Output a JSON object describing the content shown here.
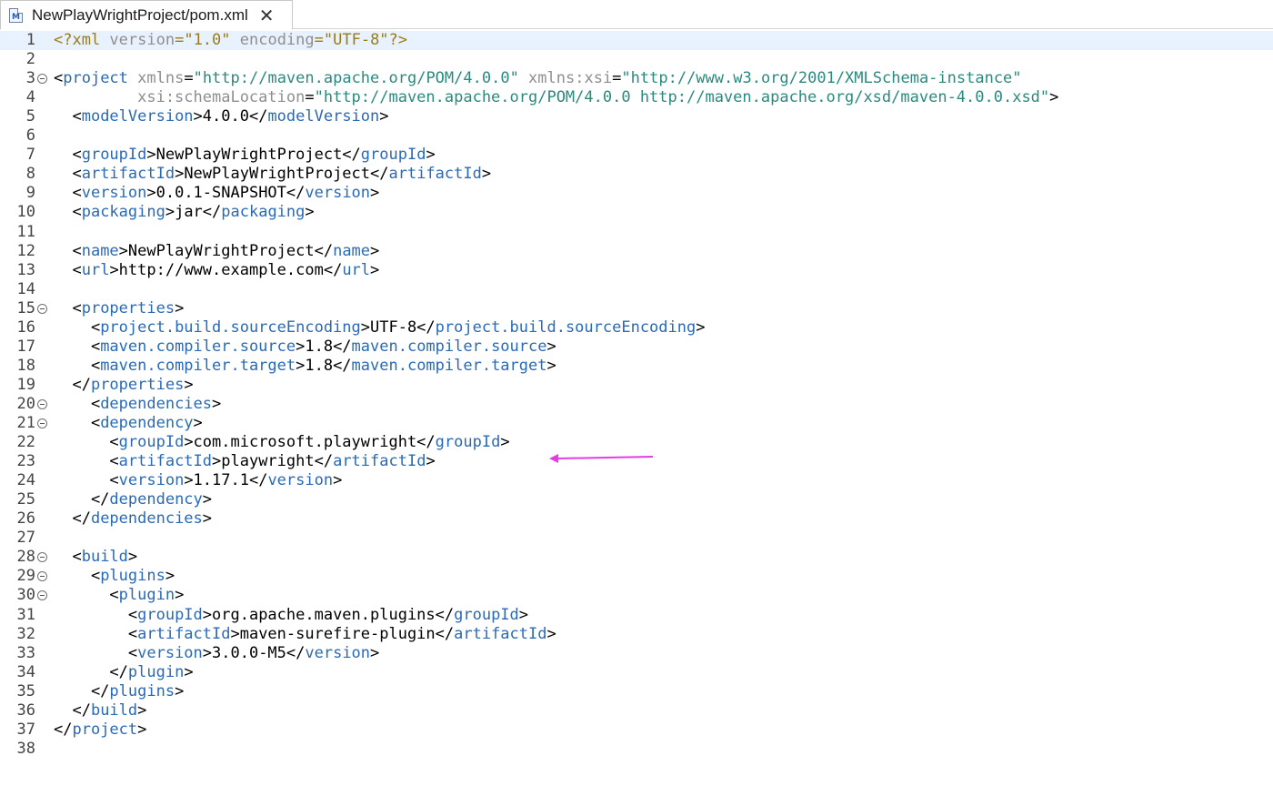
{
  "tab": {
    "title": "NewPlayWrightProject/pom.xml",
    "icon": "maven-file-icon",
    "icon_letter": "M",
    "close_glyph": "✕"
  },
  "colors": {
    "tag": "#2a6ab5",
    "attr": "#8f8f8f",
    "string": "#2a8a7e",
    "pi": "#9a7b17",
    "text": "#000000",
    "current_line": "#e8f2fe",
    "annotation_arrow": "#e43ce4"
  },
  "current_line": 1,
  "lines": [
    {
      "n": "1",
      "fold": false,
      "tokens": [
        {
          "t": "pi",
          "v": "<?xml "
        },
        {
          "t": "attr",
          "v": "version"
        },
        {
          "t": "pi",
          "v": "="
        },
        {
          "t": "pi",
          "v": "\"1.0\""
        },
        {
          "t": "attr",
          "v": " encoding"
        },
        {
          "t": "pi",
          "v": "="
        },
        {
          "t": "pi",
          "v": "\"UTF-8\""
        },
        {
          "t": "pi",
          "v": "?>"
        }
      ]
    },
    {
      "n": "2",
      "fold": false,
      "tokens": []
    },
    {
      "n": "3",
      "fold": true,
      "tokens": [
        {
          "t": "text",
          "v": "<"
        },
        {
          "t": "tag",
          "v": "project"
        },
        {
          "t": "attr",
          "v": " xmlns"
        },
        {
          "t": "text",
          "v": "="
        },
        {
          "t": "string",
          "v": "\"http://maven.apache.org/POM/4.0.0\""
        },
        {
          "t": "attr",
          "v": " xmlns:xsi"
        },
        {
          "t": "text",
          "v": "="
        },
        {
          "t": "string",
          "v": "\"http://www.w3.org/2001/XMLSchema-instance\""
        }
      ]
    },
    {
      "n": "4",
      "fold": false,
      "tokens": [
        {
          "t": "attr",
          "v": "         xsi:schemaLocation"
        },
        {
          "t": "text",
          "v": "="
        },
        {
          "t": "string",
          "v": "\"http://maven.apache.org/POM/4.0.0 http://maven.apache.org/xsd/maven-4.0.0.xsd\""
        },
        {
          "t": "text",
          "v": ">"
        }
      ]
    },
    {
      "n": "5",
      "fold": false,
      "tokens": [
        {
          "t": "text",
          "v": "  <"
        },
        {
          "t": "tag",
          "v": "modelVersion"
        },
        {
          "t": "text",
          "v": ">4.0.0</"
        },
        {
          "t": "tag",
          "v": "modelVersion"
        },
        {
          "t": "text",
          "v": ">"
        }
      ]
    },
    {
      "n": "6",
      "fold": false,
      "tokens": []
    },
    {
      "n": "7",
      "fold": false,
      "tokens": [
        {
          "t": "text",
          "v": "  <"
        },
        {
          "t": "tag",
          "v": "groupId"
        },
        {
          "t": "text",
          "v": ">NewPlayWrightProject</"
        },
        {
          "t": "tag",
          "v": "groupId"
        },
        {
          "t": "text",
          "v": ">"
        }
      ]
    },
    {
      "n": "8",
      "fold": false,
      "tokens": [
        {
          "t": "text",
          "v": "  <"
        },
        {
          "t": "tag",
          "v": "artifactId"
        },
        {
          "t": "text",
          "v": ">NewPlayWrightProject</"
        },
        {
          "t": "tag",
          "v": "artifactId"
        },
        {
          "t": "text",
          "v": ">"
        }
      ]
    },
    {
      "n": "9",
      "fold": false,
      "tokens": [
        {
          "t": "text",
          "v": "  <"
        },
        {
          "t": "tag",
          "v": "version"
        },
        {
          "t": "text",
          "v": ">0.0.1-SNAPSHOT</"
        },
        {
          "t": "tag",
          "v": "version"
        },
        {
          "t": "text",
          "v": ">"
        }
      ]
    },
    {
      "n": "10",
      "fold": false,
      "tokens": [
        {
          "t": "text",
          "v": "  <"
        },
        {
          "t": "tag",
          "v": "packaging"
        },
        {
          "t": "text",
          "v": ">jar</"
        },
        {
          "t": "tag",
          "v": "packaging"
        },
        {
          "t": "text",
          "v": ">"
        }
      ]
    },
    {
      "n": "11",
      "fold": false,
      "tokens": []
    },
    {
      "n": "12",
      "fold": false,
      "tokens": [
        {
          "t": "text",
          "v": "  <"
        },
        {
          "t": "tag",
          "v": "name"
        },
        {
          "t": "text",
          "v": ">NewPlayWrightProject</"
        },
        {
          "t": "tag",
          "v": "name"
        },
        {
          "t": "text",
          "v": ">"
        }
      ]
    },
    {
      "n": "13",
      "fold": false,
      "tokens": [
        {
          "t": "text",
          "v": "  <"
        },
        {
          "t": "tag",
          "v": "url"
        },
        {
          "t": "text",
          "v": ">http://www.example.com</"
        },
        {
          "t": "tag",
          "v": "url"
        },
        {
          "t": "text",
          "v": ">"
        }
      ]
    },
    {
      "n": "14",
      "fold": false,
      "tokens": []
    },
    {
      "n": "15",
      "fold": true,
      "tokens": [
        {
          "t": "text",
          "v": "  <"
        },
        {
          "t": "tag",
          "v": "properties"
        },
        {
          "t": "text",
          "v": ">"
        }
      ]
    },
    {
      "n": "16",
      "fold": false,
      "tokens": [
        {
          "t": "text",
          "v": "    <"
        },
        {
          "t": "tag",
          "v": "project.build.sourceEncoding"
        },
        {
          "t": "text",
          "v": ">UTF-8</"
        },
        {
          "t": "tag",
          "v": "project.build.sourceEncoding"
        },
        {
          "t": "text",
          "v": ">"
        }
      ]
    },
    {
      "n": "17",
      "fold": false,
      "tokens": [
        {
          "t": "text",
          "v": "    <"
        },
        {
          "t": "tag",
          "v": "maven.compiler.source"
        },
        {
          "t": "text",
          "v": ">1.8</"
        },
        {
          "t": "tag",
          "v": "maven.compiler.source"
        },
        {
          "t": "text",
          "v": ">"
        }
      ]
    },
    {
      "n": "18",
      "fold": false,
      "tokens": [
        {
          "t": "text",
          "v": "    <"
        },
        {
          "t": "tag",
          "v": "maven.compiler.target"
        },
        {
          "t": "text",
          "v": ">1.8</"
        },
        {
          "t": "tag",
          "v": "maven.compiler.target"
        },
        {
          "t": "text",
          "v": ">"
        }
      ]
    },
    {
      "n": "19",
      "fold": false,
      "tokens": [
        {
          "t": "text",
          "v": "  </"
        },
        {
          "t": "tag",
          "v": "properties"
        },
        {
          "t": "text",
          "v": ">"
        }
      ]
    },
    {
      "n": "20",
      "fold": true,
      "tokens": [
        {
          "t": "text",
          "v": "    <"
        },
        {
          "t": "tag",
          "v": "dependencies"
        },
        {
          "t": "text",
          "v": ">"
        }
      ]
    },
    {
      "n": "21",
      "fold": true,
      "tokens": [
        {
          "t": "text",
          "v": "    <"
        },
        {
          "t": "tag",
          "v": "dependency"
        },
        {
          "t": "text",
          "v": ">"
        }
      ]
    },
    {
      "n": "22",
      "fold": false,
      "tokens": [
        {
          "t": "text",
          "v": "      <"
        },
        {
          "t": "tag",
          "v": "groupId"
        },
        {
          "t": "text",
          "v": ">com.microsoft.playwright</"
        },
        {
          "t": "tag",
          "v": "groupId"
        },
        {
          "t": "text",
          "v": ">"
        }
      ]
    },
    {
      "n": "23",
      "fold": false,
      "tokens": [
        {
          "t": "text",
          "v": "      <"
        },
        {
          "t": "tag",
          "v": "artifactId"
        },
        {
          "t": "text",
          "v": ">playwright</"
        },
        {
          "t": "tag",
          "v": "artifactId"
        },
        {
          "t": "text",
          "v": ">"
        }
      ]
    },
    {
      "n": "24",
      "fold": false,
      "tokens": [
        {
          "t": "text",
          "v": "      <"
        },
        {
          "t": "tag",
          "v": "version"
        },
        {
          "t": "text",
          "v": ">1.17.1</"
        },
        {
          "t": "tag",
          "v": "version"
        },
        {
          "t": "text",
          "v": ">"
        }
      ]
    },
    {
      "n": "25",
      "fold": false,
      "tokens": [
        {
          "t": "text",
          "v": "    </"
        },
        {
          "t": "tag",
          "v": "dependency"
        },
        {
          "t": "text",
          "v": ">"
        }
      ]
    },
    {
      "n": "26",
      "fold": false,
      "tokens": [
        {
          "t": "text",
          "v": "  </"
        },
        {
          "t": "tag",
          "v": "dependencies"
        },
        {
          "t": "text",
          "v": ">"
        }
      ]
    },
    {
      "n": "27",
      "fold": false,
      "tokens": []
    },
    {
      "n": "28",
      "fold": true,
      "tokens": [
        {
          "t": "text",
          "v": "  <"
        },
        {
          "t": "tag",
          "v": "build"
        },
        {
          "t": "text",
          "v": ">"
        }
      ]
    },
    {
      "n": "29",
      "fold": true,
      "tokens": [
        {
          "t": "text",
          "v": "    <"
        },
        {
          "t": "tag",
          "v": "plugins"
        },
        {
          "t": "text",
          "v": ">"
        }
      ]
    },
    {
      "n": "30",
      "fold": true,
      "tokens": [
        {
          "t": "text",
          "v": "      <"
        },
        {
          "t": "tag",
          "v": "plugin"
        },
        {
          "t": "text",
          "v": ">"
        }
      ]
    },
    {
      "n": "31",
      "fold": false,
      "tokens": [
        {
          "t": "text",
          "v": "        <"
        },
        {
          "t": "tag",
          "v": "groupId"
        },
        {
          "t": "text",
          "v": ">org.apache.maven.plugins</"
        },
        {
          "t": "tag",
          "v": "groupId"
        },
        {
          "t": "text",
          "v": ">"
        }
      ]
    },
    {
      "n": "32",
      "fold": false,
      "tokens": [
        {
          "t": "text",
          "v": "        <"
        },
        {
          "t": "tag",
          "v": "artifactId"
        },
        {
          "t": "text",
          "v": ">maven-surefire-plugin</"
        },
        {
          "t": "tag",
          "v": "artifactId"
        },
        {
          "t": "text",
          "v": ">"
        }
      ]
    },
    {
      "n": "33",
      "fold": false,
      "tokens": [
        {
          "t": "text",
          "v": "        <"
        },
        {
          "t": "tag",
          "v": "version"
        },
        {
          "t": "text",
          "v": ">3.0.0-M5</"
        },
        {
          "t": "tag",
          "v": "version"
        },
        {
          "t": "text",
          "v": ">"
        }
      ]
    },
    {
      "n": "34",
      "fold": false,
      "tokens": [
        {
          "t": "text",
          "v": "      </"
        },
        {
          "t": "tag",
          "v": "plugin"
        },
        {
          "t": "text",
          "v": ">"
        }
      ]
    },
    {
      "n": "35",
      "fold": false,
      "tokens": [
        {
          "t": "text",
          "v": "    </"
        },
        {
          "t": "tag",
          "v": "plugins"
        },
        {
          "t": "text",
          "v": ">"
        }
      ]
    },
    {
      "n": "36",
      "fold": false,
      "tokens": [
        {
          "t": "text",
          "v": "  </"
        },
        {
          "t": "tag",
          "v": "build"
        },
        {
          "t": "text",
          "v": ">"
        }
      ]
    },
    {
      "n": "37",
      "fold": false,
      "tokens": [
        {
          "t": "text",
          "v": "</"
        },
        {
          "t": "tag",
          "v": "project"
        },
        {
          "t": "text",
          "v": ">"
        }
      ]
    },
    {
      "n": "38",
      "fold": false,
      "tokens": []
    }
  ]
}
